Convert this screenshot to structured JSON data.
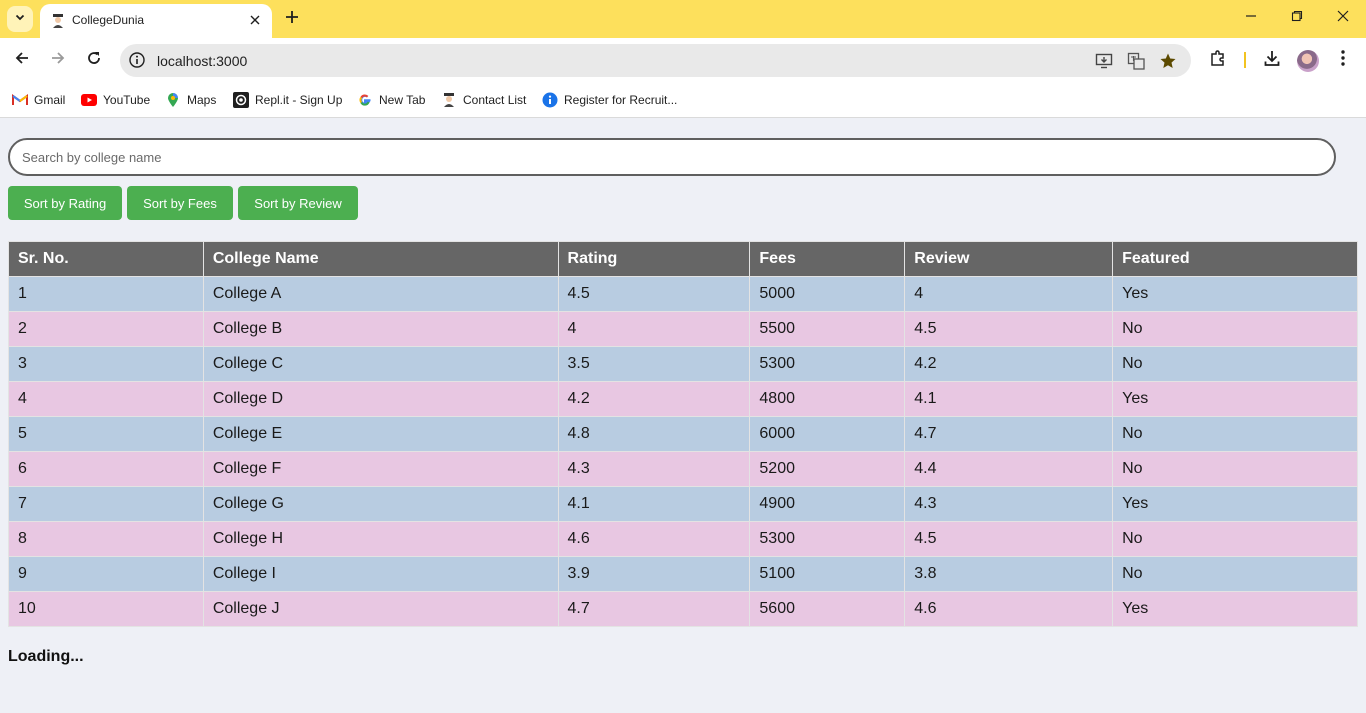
{
  "browser": {
    "tab_title": "CollegeDunia",
    "url": "localhost:3000",
    "bookmarks": [
      {
        "label": "Gmail",
        "icon": "gmail-icon"
      },
      {
        "label": "YouTube",
        "icon": "youtube-icon"
      },
      {
        "label": "Maps",
        "icon": "maps-icon"
      },
      {
        "label": "Repl.it - Sign Up",
        "icon": "replit-icon"
      },
      {
        "label": "New Tab",
        "icon": "google-icon"
      },
      {
        "label": "Contact List",
        "icon": "contact-list-icon"
      },
      {
        "label": "Register for Recruit...",
        "icon": "info-icon"
      }
    ]
  },
  "search": {
    "placeholder": "Search by college name",
    "value": ""
  },
  "sort_buttons": {
    "rating": "Sort by Rating",
    "fees": "Sort by Fees",
    "review": "Sort by Review"
  },
  "table": {
    "headers": [
      "Sr. No.",
      "College Name",
      "Rating",
      "Fees",
      "Review",
      "Featured"
    ],
    "rows": [
      [
        "1",
        "College A",
        "4.5",
        "5000",
        "4",
        "Yes"
      ],
      [
        "2",
        "College B",
        "4",
        "5500",
        "4.5",
        "No"
      ],
      [
        "3",
        "College C",
        "3.5",
        "5300",
        "4.2",
        "No"
      ],
      [
        "4",
        "College D",
        "4.2",
        "4800",
        "4.1",
        "Yes"
      ],
      [
        "5",
        "College E",
        "4.8",
        "6000",
        "4.7",
        "No"
      ],
      [
        "6",
        "College F",
        "4.3",
        "5200",
        "4.4",
        "No"
      ],
      [
        "7",
        "College G",
        "4.1",
        "4900",
        "4.3",
        "Yes"
      ],
      [
        "8",
        "College H",
        "4.6",
        "5300",
        "4.5",
        "No"
      ],
      [
        "9",
        "College I",
        "3.9",
        "5100",
        "3.8",
        "No"
      ],
      [
        "10",
        "College J",
        "4.7",
        "5600",
        "4.6",
        "Yes"
      ]
    ]
  },
  "status": {
    "loading_text": "Loading..."
  },
  "colors": {
    "tabbar": "#fde05c",
    "button_green": "#4caf50",
    "header_gray": "#666666",
    "row_blue": "#b8cce1",
    "row_pink": "#e8c7e2"
  }
}
